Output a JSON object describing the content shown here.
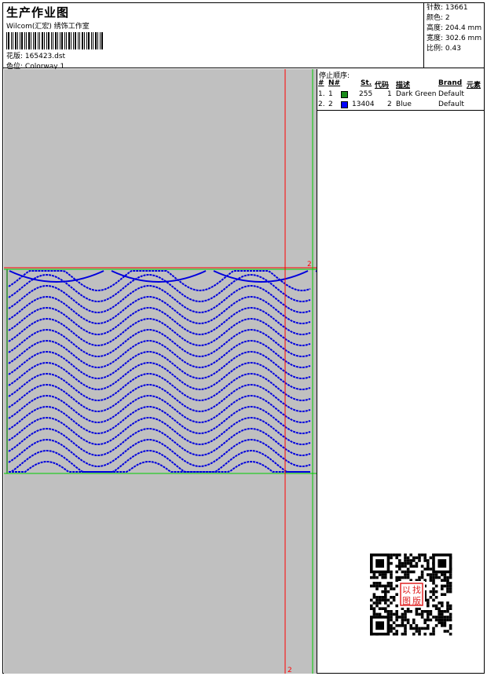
{
  "header": {
    "title": "生产作业图",
    "company": "Wilcom(汇宏) 绣饰工作室",
    "design_label": "花版:",
    "design_value": "165423.dst",
    "colorway_label": "色位:",
    "colorway_value": "Colorway 1"
  },
  "stats": {
    "stitches_label": "针数:",
    "stitches_value": "13661",
    "colors_label": "颜色:",
    "colors_value": "2",
    "height_label": "高度:",
    "height_value": "204.4 mm",
    "width_label": "宽度:",
    "width_value": "302.6 mm",
    "scale_label": "比例:",
    "scale_value": "0.43"
  },
  "stop_sequence": {
    "title": "停止顺序:",
    "columns": [
      "#",
      "N#",
      "St.",
      "代码",
      "描述",
      "Brand",
      "元素"
    ],
    "rows": [
      {
        "num": "1.",
        "n": "1",
        "color": "#1a8a1a",
        "st": "255",
        "code": "1",
        "desc": "Dark Green",
        "brand": "Default"
      },
      {
        "num": "2.",
        "n": "2",
        "color": "#0000ff",
        "st": "13404",
        "code": "2",
        "desc": "Blue",
        "brand": "Default"
      }
    ]
  },
  "canvas": {
    "background": "#c0c0c0",
    "marker_label_top": "2",
    "marker_label_bottom": "2",
    "stitch_color": "#0000dd",
    "guide_red": "#ff0000",
    "guide_green": "#00cc00"
  },
  "qr": {
    "stamp_text": [
      "以",
      "图",
      "找",
      "版"
    ]
  }
}
